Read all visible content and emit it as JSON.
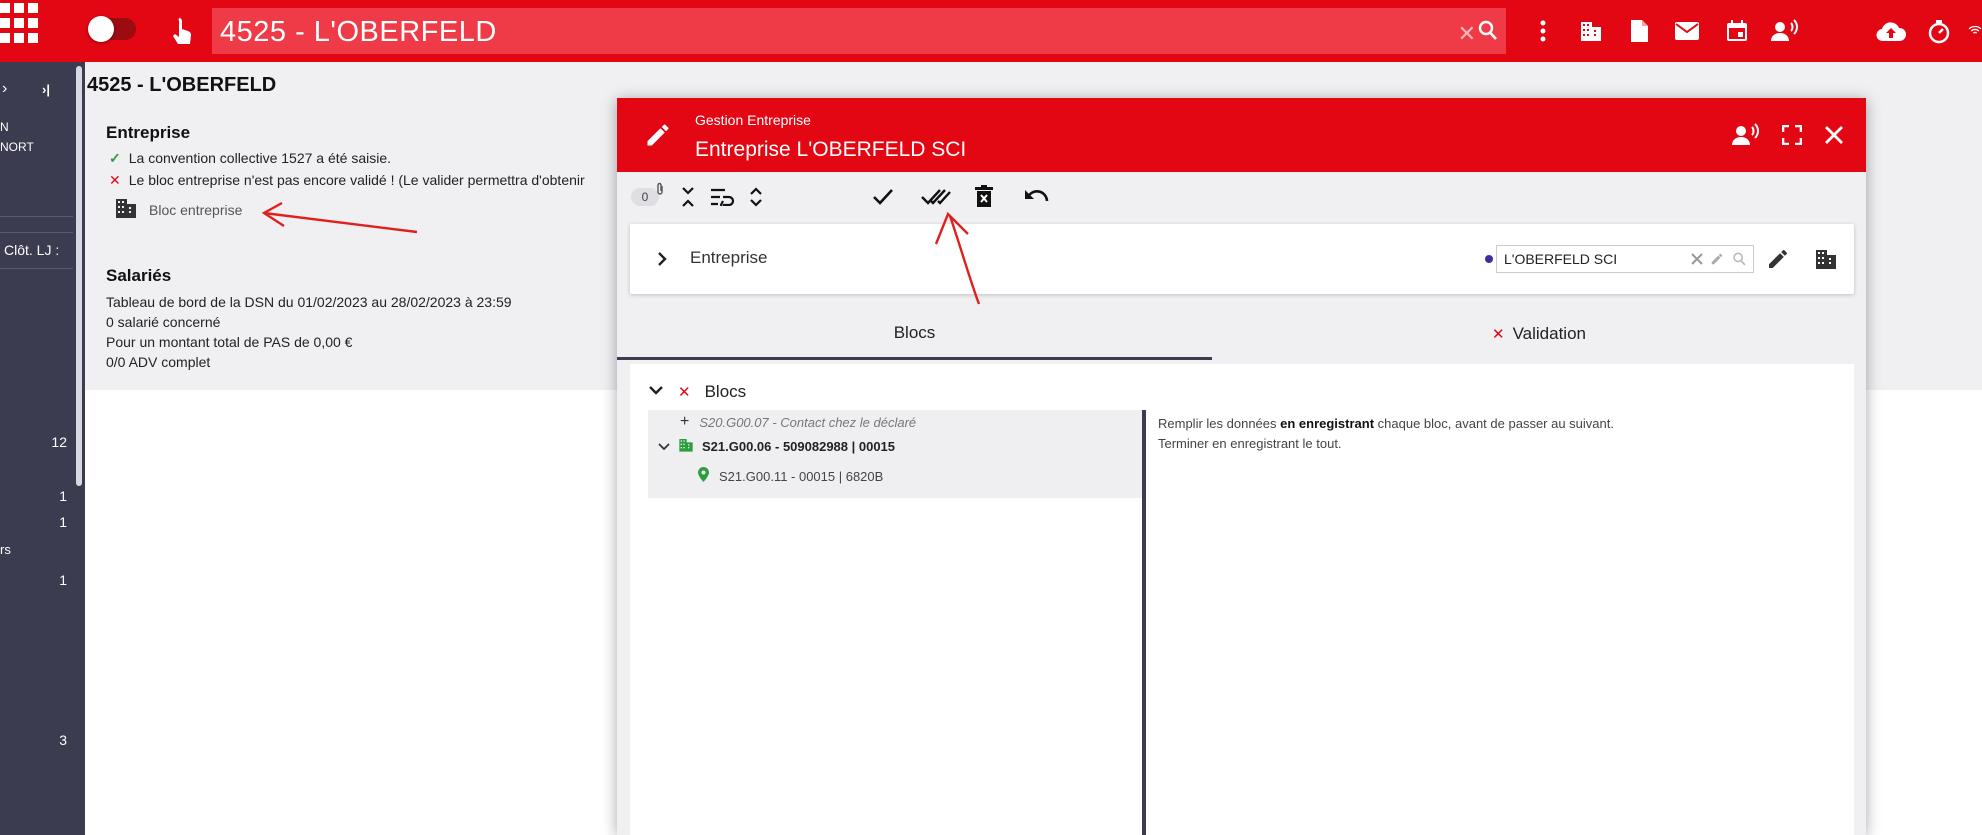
{
  "topbar": {
    "search_value": "4525 - L'OBERFELD",
    "clear_glyph": "✕"
  },
  "sidebar": {
    "items": [
      {
        "label": "N"
      },
      {
        "label": "NORT"
      },
      {
        "label": "Clôt. LJ :"
      },
      {
        "label": "rs"
      }
    ],
    "numbers": [
      "12",
      "1",
      "1",
      "1",
      "3"
    ],
    "arrow_right": "›",
    "arrow_last": "›|"
  },
  "page": {
    "title": "4525 - L'OBERFELD",
    "entreprise": {
      "heading": "Entreprise",
      "line1": "La convention collective 1527 a été saisie.",
      "line2": "Le bloc entreprise n'est pas encore validé ! (Le valider permettra d'obtenir",
      "bloc_link": "Bloc entreprise"
    },
    "salaries": {
      "heading": "Salariés",
      "lines": [
        "Tableau de bord de la DSN du 01/02/2023 au 28/02/2023 à 23:59",
        "0 salarié concerné",
        "Pour un montant total de PAS de 0,00 €",
        "0/0 ADV complet"
      ]
    }
  },
  "modal": {
    "subtitle": "Gestion Entreprise",
    "title": "Entreprise L'OBERFELD SCI",
    "attachments_count": "0",
    "card": {
      "label": "Entreprise",
      "input_value": "L'OBERFELD SCI"
    },
    "tabs": [
      {
        "label": "Blocs",
        "active": true
      },
      {
        "label": "Validation",
        "active": false
      }
    ],
    "blocs_label": "Blocs",
    "tree": [
      {
        "text": "S20.G00.07 - Contact chez le déclaré"
      },
      {
        "text": "S21.G00.06 - 509082988 | 00015"
      },
      {
        "text": "S21.G00.11 - 00015 | 6820B"
      }
    ],
    "help": {
      "part1": "Remplir les données ",
      "bold": "en enregistrant",
      "part2": " chaque bloc, avant de passer au suivant.",
      "line2": "Terminer en enregistrant le tout."
    }
  },
  "colors": {
    "brand_red": "#e30613",
    "sidebar_dark": "#3c3c50",
    "ok_green": "#2e9d3e",
    "annotation_red": "#e0201f"
  },
  "icons": [
    "apps-grid-icon",
    "touch-icon",
    "search-icon",
    "more-vert-icon",
    "building-icon",
    "document-icon",
    "mail-icon",
    "calendar-icon",
    "voice-icon",
    "cloud-upload-icon",
    "timer-icon",
    "edit-icon",
    "fullscreen-icon",
    "close-icon"
  ]
}
